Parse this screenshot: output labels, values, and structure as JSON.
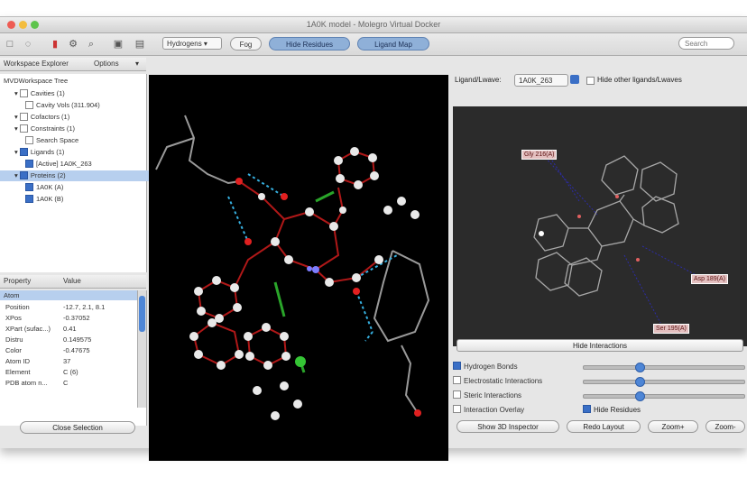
{
  "window": {
    "title": "1A0K model - Molegro Virtual Docker",
    "traffic_colors": [
      "#ee5c54",
      "#f3bd3e",
      "#5ec44d"
    ]
  },
  "toolbar": {
    "icons": [
      "new-icon",
      "open-icon",
      "save-icon",
      "settings-icon",
      "search-icon",
      "image-icon",
      "print-icon"
    ],
    "hydrogens_label": "Hydrogens",
    "fog_label": "Fog",
    "hide_residues_label": "Hide Residues",
    "ligand_map_label": "Ligand Map",
    "search_placeholder": "Search"
  },
  "workspace": {
    "header_title": "Workspace Explorer",
    "options_label": "Options",
    "root_label": "MVDWorkspace Tree",
    "items": [
      {
        "label": "Cavities (1)",
        "indent": 1,
        "checked": false,
        "selected": false
      },
      {
        "label": "Cavity Vols (311.904)",
        "indent": 2,
        "checked": false,
        "selected": false
      },
      {
        "label": "Cofactors (1)",
        "indent": 1,
        "checked": false,
        "selected": false
      },
      {
        "label": "Constraints (1)",
        "indent": 1,
        "checked": false,
        "selected": false
      },
      {
        "label": "Search Space",
        "indent": 2,
        "checked": false,
        "selected": false
      },
      {
        "label": "Ligands (1)",
        "indent": 1,
        "checked": true,
        "selected": false
      },
      {
        "label": "[Active] 1A0K_263",
        "indent": 2,
        "checked": true,
        "selected": false
      },
      {
        "label": "Proteins (2)",
        "indent": 1,
        "checked": true,
        "selected": true
      },
      {
        "label": "1A0K (A)",
        "indent": 2,
        "checked": true,
        "selected": false
      },
      {
        "label": "1A0K (B)",
        "indent": 2,
        "checked": true,
        "selected": false
      }
    ]
  },
  "properties": {
    "col_property": "Property",
    "col_value": "Value",
    "section": "Atom",
    "rows": [
      {
        "name": "Position",
        "value": "-12.7, 2.1, 8.1"
      },
      {
        "name": "XPos",
        "value": "-0.37052"
      },
      {
        "name": "XPart (sufac...)",
        "value": "0.41"
      },
      {
        "name": "Distru",
        "value": "0.149575"
      },
      {
        "name": "Color",
        "value": "-0.47675"
      },
      {
        "name": "Atom ID",
        "value": "37"
      },
      {
        "name": "Element",
        "value": "C (6)"
      },
      {
        "name": "PDB atom n...",
        "value": "C"
      }
    ],
    "close_label": "Close Selection"
  },
  "ligand_panel": {
    "ligand_label": "Ligand/Lwave:",
    "ligand_value": "1A0K_263",
    "hide_other_label": "Hide other ligands/Lwaves",
    "hide_interactions_label": "Hide Interactions",
    "options": [
      {
        "label": "Hydrogen Bonds",
        "checked": true,
        "slider": 0.35
      },
      {
        "label": "Electrostatic Interactions",
        "checked": false,
        "slider": 0.35
      },
      {
        "label": "Steric Interactions",
        "checked": false,
        "slider": 0.35
      },
      {
        "label": "Interaction Overlay",
        "checked": false,
        "slider": null
      }
    ],
    "hide_residues_label": "Hide Residues",
    "hide_residues_checked": true,
    "buttons": [
      "Show 3D Inspector",
      "Redo Layout",
      "Zoom+",
      "Zoom-"
    ],
    "residue_labels": [
      "Gly 216(A)",
      "Asp 189(A)",
      "Ser 195(A)"
    ]
  },
  "colors": {
    "accent_blue": "#3a6fc6",
    "viewer_bg": "#000000",
    "viewer2d_bg": "#2b2b2b"
  }
}
